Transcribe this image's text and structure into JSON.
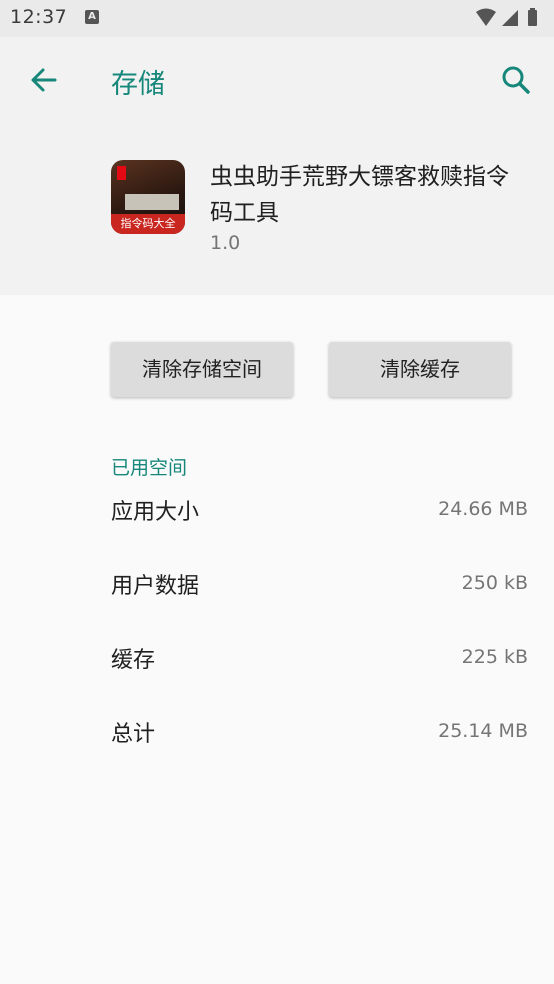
{
  "status_bar": {
    "time": "12:37",
    "notification_icon": "A"
  },
  "toolbar": {
    "title": "存储",
    "back_icon": "arrow-back-icon",
    "search_icon": "search-icon"
  },
  "app": {
    "icon_banner": "指令码大全",
    "name": "虫虫助手荒野大镖客救赎指令码工具",
    "version": "1.0"
  },
  "actions": {
    "clear_storage_label": "清除存储空间",
    "clear_cache_label": "清除缓存"
  },
  "storage": {
    "section_title": "已用空间",
    "rows": [
      {
        "label": "应用大小",
        "value": "24.66 MB"
      },
      {
        "label": "用户数据",
        "value": "250 kB"
      },
      {
        "label": "缓存",
        "value": "225 kB"
      },
      {
        "label": "总计",
        "value": "25.14 MB"
      }
    ]
  },
  "colors": {
    "accent": "#16877a",
    "header_bg": "#f2f2f2",
    "body_bg": "#fafafa"
  }
}
